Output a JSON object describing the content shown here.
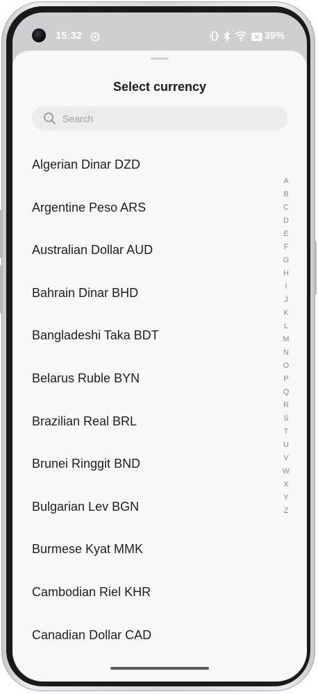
{
  "status_bar": {
    "time": "15:32",
    "battery": "39%",
    "icons": [
      "camera-cutout",
      "cast-icon",
      "vibrate-icon",
      "bluetooth-icon",
      "wifi-icon",
      "battery-saver-icon"
    ]
  },
  "sheet": {
    "title": "Select currency",
    "search": {
      "placeholder": "Search",
      "value": ""
    },
    "currencies": [
      "Algerian Dinar DZD",
      "Argentine Peso ARS",
      "Australian Dollar AUD",
      "Bahrain Dinar BHD",
      "Bangladeshi Taka BDT",
      "Belarus Ruble BYN",
      "Brazilian Real BRL",
      "Brunei Ringgit BND",
      "Bulgarian Lev BGN",
      "Burmese Kyat MMK",
      "Cambodian Riel KHR",
      "Canadian Dollar CAD"
    ],
    "index_letters": [
      "A",
      "B",
      "C",
      "D",
      "E",
      "F",
      "G",
      "H",
      "I",
      "J",
      "K",
      "L",
      "M",
      "N",
      "O",
      "P",
      "Q",
      "R",
      "S",
      "T",
      "U",
      "V",
      "W",
      "X",
      "Y",
      "Z"
    ]
  },
  "colors": {
    "sheet_background": "#f8f8f8",
    "search_background": "#ebebeb",
    "text_primary": "#1e1e1e",
    "index_text": "#8a8a8a"
  }
}
